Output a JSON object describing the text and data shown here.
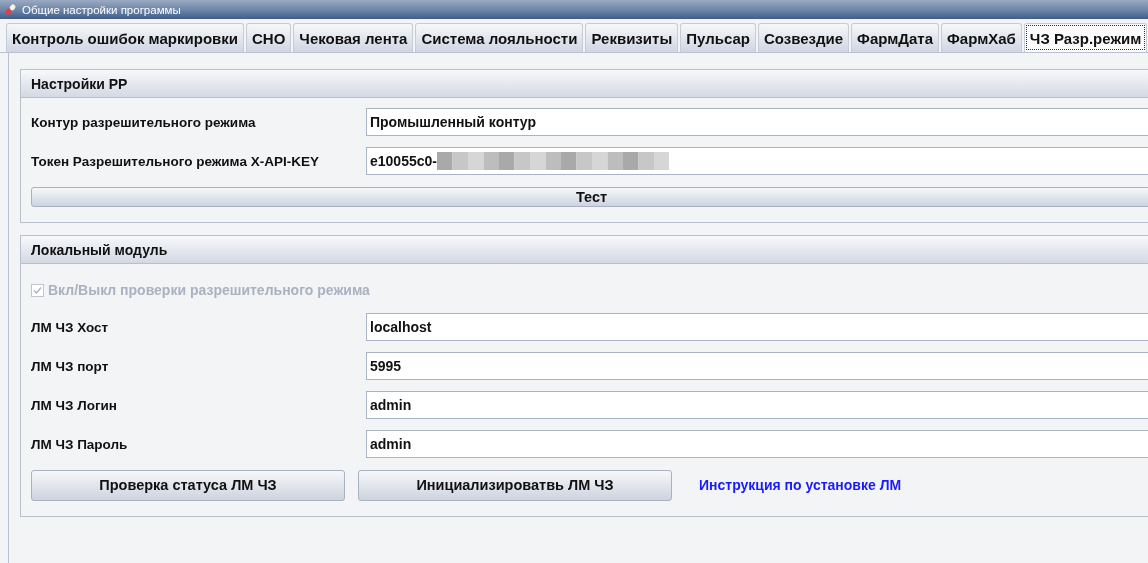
{
  "window": {
    "title": "Общие настройки программы"
  },
  "tabs": [
    {
      "label": "Контроль ошибок маркировки",
      "selected": false
    },
    {
      "label": "СНО",
      "selected": false
    },
    {
      "label": "Чековая лента",
      "selected": false
    },
    {
      "label": "Система лояльности",
      "selected": false
    },
    {
      "label": "Реквизиты",
      "selected": false
    },
    {
      "label": "Пульсар",
      "selected": false
    },
    {
      "label": "Созвездие",
      "selected": false
    },
    {
      "label": "ФармДата",
      "selected": false
    },
    {
      "label": "ФармХаб",
      "selected": false
    },
    {
      "label": "ЧЗ Разр.режим",
      "selected": true
    }
  ],
  "groups": [
    {
      "title": "Настройки РР",
      "rows": [
        {
          "kind": "field",
          "label": "Контур разрешительного режима",
          "value": "Промышленный контур",
          "redacted": false
        },
        {
          "kind": "field",
          "label": "Токен Разрешительного режима X-API-KEY",
          "value": "e10055c0-",
          "redacted": true
        },
        {
          "kind": "button",
          "label": "Тест"
        }
      ]
    },
    {
      "title": "Локальный модуль",
      "rows": [
        {
          "kind": "checkbox",
          "label": "Вкл/Выкл проверки разрешительного режима",
          "checked": true,
          "disabled": true
        },
        {
          "kind": "field",
          "label": "ЛМ ЧЗ Хост",
          "value": "localhost",
          "redacted": false
        },
        {
          "kind": "field",
          "label": "ЛМ ЧЗ порт",
          "value": "5995",
          "redacted": false
        },
        {
          "kind": "field",
          "label": "ЛМ ЧЗ Логин",
          "value": "admin",
          "redacted": false
        },
        {
          "kind": "field",
          "label": "ЛМ ЧЗ Пароль",
          "value": "admin",
          "redacted": false
        },
        {
          "kind": "actions",
          "buttons": [
            "Проверка статуса ЛМ ЧЗ",
            "Инициализироватвь ЛМ ЧЗ"
          ],
          "link": "Инструкция по установке ЛМ"
        }
      ]
    }
  ]
}
